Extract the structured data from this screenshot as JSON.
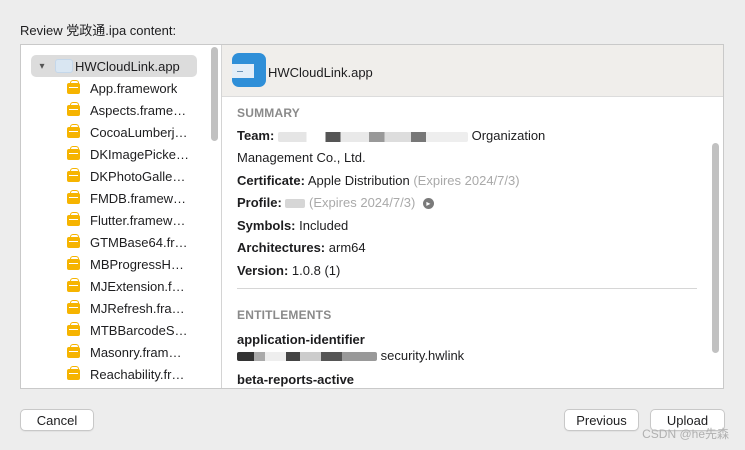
{
  "dialog": {
    "title": "Review 党政通.ipa content:"
  },
  "tree": {
    "root": {
      "label": "HWCloudLink.app",
      "expanded": true
    },
    "items": [
      {
        "label": "App.framework"
      },
      {
        "label": "Aspects.frame…"
      },
      {
        "label": "CocoaLumberj…"
      },
      {
        "label": "DKImagePicke…"
      },
      {
        "label": "DKPhotoGalle…"
      },
      {
        "label": "FMDB.framew…"
      },
      {
        "label": "Flutter.framew…"
      },
      {
        "label": "GTMBase64.fr…"
      },
      {
        "label": "MBProgressH…"
      },
      {
        "label": "MJExtension.f…"
      },
      {
        "label": "MJRefresh.fra…"
      },
      {
        "label": "MTBBarcodeS…"
      },
      {
        "label": "Masonry.fram…"
      },
      {
        "label": "Reachability.fr…"
      }
    ]
  },
  "detail": {
    "header": {
      "app_name": "HWCloudLink.app"
    },
    "summary": {
      "title": "SUMMARY",
      "team_label": "Team:",
      "team_value": "Organization",
      "team_value_line2": "Management Co., Ltd.",
      "certificate_label": "Certificate:",
      "certificate_value": "Apple Distribution",
      "certificate_expiry": "(Expires 2024/7/3)",
      "profile_label": "Profile:",
      "profile_expiry": "(Expires 2024/7/3)",
      "symbols_label": "Symbols:",
      "symbols_value": "Included",
      "architectures_label": "Architectures:",
      "architectures_value": "arm64",
      "version_label": "Version:",
      "version_value": "1.0.8 (1)"
    },
    "entitlements": {
      "title": "ENTITLEMENTS",
      "app_id_label": "application-identifier",
      "app_id_value": "security.hwlink",
      "beta_label": "beta-reports-active"
    }
  },
  "buttons": {
    "cancel": "Cancel",
    "previous": "Previous",
    "upload": "Upload"
  },
  "watermark": "CSDN @he先森",
  "icons": {
    "framework": "framework-toolbox-icon",
    "app": "app-icon",
    "disclosure": "chevron-down-icon",
    "reveal": "arrow-circle-right-icon"
  },
  "colors": {
    "framework_icon": "#f6b400",
    "app_icon": "#2f8fd8",
    "selection": "#dcdcdc"
  }
}
